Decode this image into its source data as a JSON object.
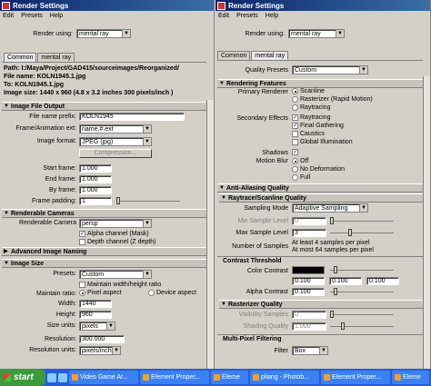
{
  "left": {
    "title": "Render Settings",
    "menu": [
      "Edit",
      "Presets",
      "Help"
    ],
    "render_using_label": "Render using:",
    "render_using_value": "mental ray",
    "tabs": [
      "Common",
      "mental ray"
    ],
    "path_label": "Path: I:/Maya/Project/GAD415/sourceimages/Reorganized/",
    "file_name": "File name:  KOLN1945.1.jpg",
    "to": "To:             KOLN1945.1.jpg",
    "image_size": "Image size:  1440 x 960 (4.8 x 3.2 inches 300 pixels/inch )",
    "image_file_output": {
      "header": "Image File Output",
      "file_name_prefix_label": "File name prefix:",
      "file_name_prefix": "KOLN1945",
      "frame_anim_ext_label": "Frame/Animation ext:",
      "frame_anim_ext": "name.#.ext",
      "image_format_label": "Image format:",
      "image_format": "JPEG (jpg)",
      "compression_label": "Compression...",
      "start_frame_label": "Start frame:",
      "start_frame": "1.000",
      "end_frame_label": "End frame:",
      "end_frame": "1.000",
      "by_frame_label": "By frame:",
      "by_frame": "1.000",
      "frame_padding_label": "Frame padding:",
      "frame_padding": "1"
    },
    "renderable_cameras": {
      "header": "Renderable Cameras",
      "camera_label": "Renderable Camera",
      "camera": "persp",
      "alpha_channel": "Alpha channel (Mask)",
      "depth_channel": "Depth channel (Z depth)"
    },
    "advanced_naming_header": "Advanced Image Naming",
    "image_size_section": {
      "header": "Image Size",
      "presets_label": "Presets:",
      "presets": "Custom",
      "maintain_wh_ratio": "Maintain width/height ratio",
      "maintain_ratio_label": "Maintain ratio:",
      "pixel_aspect": "Pixel aspect",
      "device_aspect": "Device aspect",
      "width_label": "Width:",
      "width": "1440",
      "height_label": "Height:",
      "height": "960",
      "size_units_label": "Size units:",
      "size_units": "pixels",
      "resolution_label": "Resolution:",
      "resolution": "300.000",
      "resolution_units_label": "Resolution units:",
      "resolution_units": "pixels/inch"
    }
  },
  "right": {
    "title": "Render Settings",
    "menu": [
      "Edit",
      "Presets",
      "Help"
    ],
    "render_using_label": "Render using:",
    "render_using_value": "mental ray",
    "tabs": [
      "Common",
      "mental ray"
    ],
    "quality_presets_label": "Quality Presets",
    "quality_presets": "Custom",
    "rendering_features": {
      "header": "Rendering Features",
      "primary_renderer_label": "Primary Renderer",
      "renderers": [
        "Scanline",
        "Rasterizer (Rapid Motion)",
        "Raytracing"
      ],
      "secondary_effects_label": "Secondary Effects",
      "effects": [
        "Raytracing",
        "Final Gathering",
        "Caustics",
        "Global Illumination"
      ],
      "shadows_label": "Shadows",
      "motion_blur_label": "Motion Blur",
      "motion_blur_options": [
        "Off",
        "No Deformation",
        "Full"
      ]
    },
    "anti_aliasing_header": "Anti-Aliasing Quality",
    "raytrace_scanline": {
      "header": "Raytrace/Scanline Quality",
      "sampling_mode_label": "Sampling Mode",
      "sampling_mode": "Adaptive Sampling",
      "min_sample_label": "Min Sample Level",
      "min_sample": "0",
      "max_sample_label": "Max Sample Level",
      "max_sample": "3",
      "number_samples_label": "Number of Samples",
      "number_samples_line1": "At least 4 samples per pixel",
      "number_samples_line2": "At most 64 samples per pixel"
    },
    "contrast_threshold": {
      "header": "Contrast Threshold",
      "color_contrast_label": "Color Contrast",
      "alpha_contrast_label": "Alpha Contrast",
      "values": [
        "0.100",
        "0.100",
        "0.100"
      ],
      "alpha": "0.100"
    },
    "rasterizer_quality": {
      "header": "Rasterizer Quality",
      "visibility_samples_label": "Visibility Samples",
      "visibility_samples": "0",
      "shading_quality_label": "Shading Quality",
      "shading_quality": "1.000"
    },
    "multi_pixel": {
      "header": "Multi-Pixel Filtering",
      "filter_label": "Filter",
      "filter": "Box"
    }
  },
  "taskbar": {
    "start": "start",
    "items": [
      "Video Game Ar...",
      "Element Proper...",
      "Eleme",
      "pliang - Photob...",
      "Element Proper...",
      "Eleme"
    ]
  }
}
